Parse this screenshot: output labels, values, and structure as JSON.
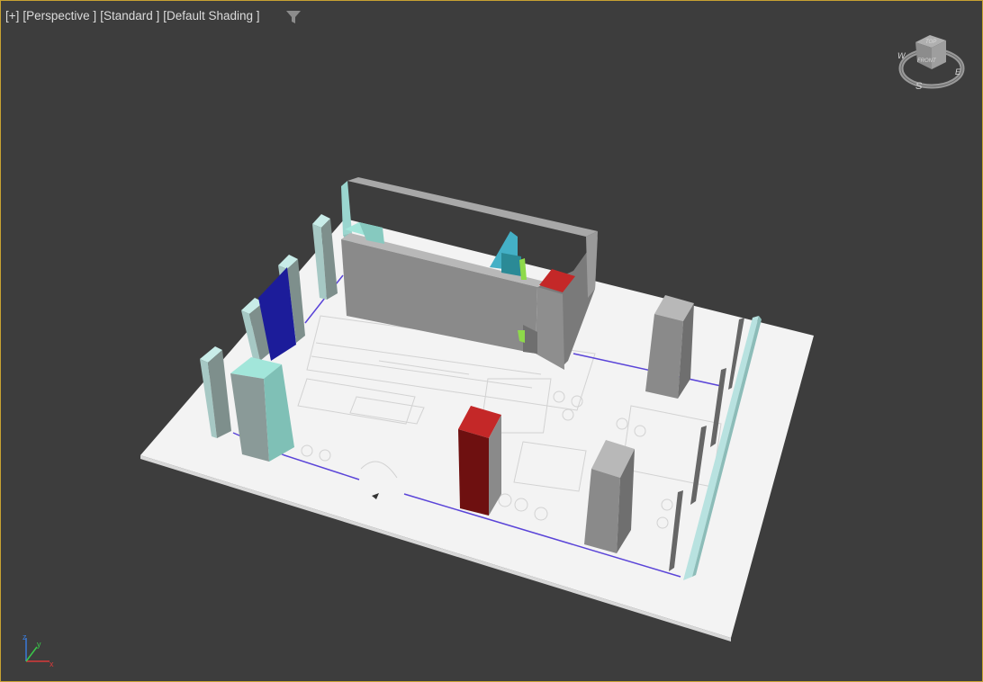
{
  "viewport": {
    "plus_label": "[+]",
    "view_label": "[Perspective ]",
    "mode_label": "[Standard ]",
    "shading_label": "[Default Shading ]"
  },
  "viewcube": {
    "face_top": "TOP",
    "face_front": "FRONT",
    "compass_w": "W",
    "compass_s": "S",
    "compass_e": "E"
  },
  "axis_tripod": {
    "x": "x",
    "y": "y",
    "z": "z"
  },
  "colors": {
    "background": "#3d3d3d",
    "border_active": "#c8a232",
    "floor": "#f2f2f2",
    "wall_gray": "#8c8c8c",
    "mint": "#9fe0d6",
    "blue_panel": "#1c1c9a",
    "red_box": "#a01414"
  },
  "icons": {
    "filter": "filter-icon",
    "viewcube": "viewcube-icon",
    "axis": "axis-tripod-icon"
  }
}
